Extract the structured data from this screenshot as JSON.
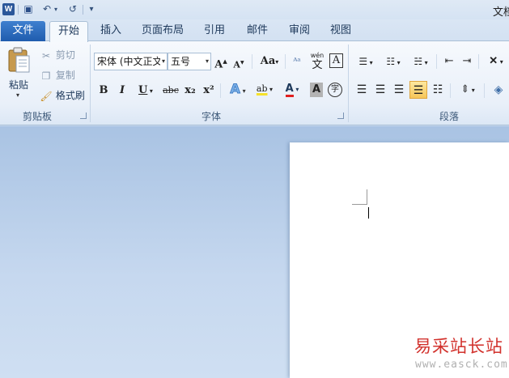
{
  "window": {
    "title": "文档"
  },
  "quick_access": {
    "app_icon": "W",
    "icons": [
      "save-icon",
      "undo-icon",
      "redo-icon",
      "customize-qat-icon"
    ],
    "glyphs": {
      "save": "▣",
      "undo": "↶",
      "redo": "↺",
      "customize": "▾"
    }
  },
  "tabs": {
    "file": "文件",
    "items": [
      "开始",
      "插入",
      "页面布局",
      "引用",
      "邮件",
      "审阅",
      "视图"
    ],
    "active": "开始"
  },
  "ribbon": {
    "clipboard": {
      "label": "剪贴板",
      "paste": "粘贴",
      "cut": "剪切",
      "copy": "复制",
      "format_painter": "格式刷"
    },
    "font": {
      "label": "字体",
      "font_name": "宋体 (中文正文)",
      "font_size": "五号",
      "grow": "A",
      "shrink": "A",
      "change_case": "Aa",
      "bold": "B",
      "italic": "I",
      "underline": "U",
      "strikethrough": "abc",
      "subscript": "x₂",
      "superscript": "x²",
      "text_effects": "A",
      "highlight": "ab",
      "font_color": "A",
      "char_shading": "A",
      "enclose": "字",
      "phonetic": "wén",
      "phonetic_char": "文",
      "char_border": "A"
    },
    "paragraph": {
      "label": "段落"
    }
  },
  "colors": {
    "accent": "#2b579a",
    "file_tab": "#2a67bd",
    "font_color_bar": "#e02020",
    "highlight_bar": "#f5e12a",
    "active_button": "#f6c659",
    "watermark": "#d2322d"
  },
  "watermark": {
    "text": "易采站长站",
    "url": "www.easck.com"
  }
}
